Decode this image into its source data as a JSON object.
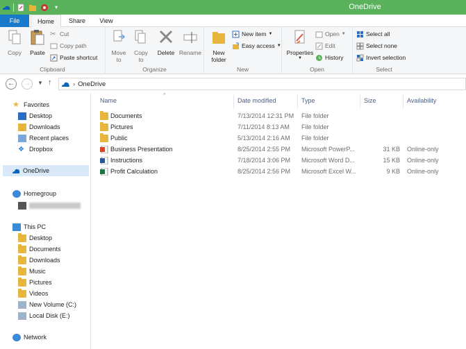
{
  "window": {
    "title": "OneDrive"
  },
  "tabs": [
    {
      "label": "File"
    },
    {
      "label": "Home"
    },
    {
      "label": "Share"
    },
    {
      "label": "View"
    }
  ],
  "ribbon": {
    "clipboard": {
      "label": "Clipboard",
      "copy": "Copy",
      "paste": "Paste",
      "cut": "Cut",
      "copy_path": "Copy path",
      "paste_shortcut": "Paste shortcut"
    },
    "organize": {
      "label": "Organize",
      "move_to": "Move\nto",
      "copy_to": "Copy\nto",
      "delete": "Delete",
      "rename": "Rename"
    },
    "new": {
      "label": "New",
      "new_folder": "New\nfolder",
      "new_item": "New item",
      "easy_access": "Easy access"
    },
    "open": {
      "label": "Open",
      "properties": "Properties",
      "open": "Open",
      "edit": "Edit",
      "history": "History"
    },
    "select": {
      "label": "Select",
      "select_all": "Select all",
      "select_none": "Select none",
      "invert_selection": "Invert selection"
    }
  },
  "address": {
    "location": "OneDrive"
  },
  "nav": {
    "favorites": "Favorites",
    "favorites_items": [
      "Desktop",
      "Downloads",
      "Recent places",
      "Dropbox"
    ],
    "onedrive": "OneDrive",
    "homegroup": "Homegroup",
    "this_pc": "This PC",
    "pc_items": [
      "Desktop",
      "Documents",
      "Downloads",
      "Music",
      "Pictures",
      "Videos",
      "New Volume (C:)",
      "Local Disk (E:)"
    ],
    "network": "Network"
  },
  "columns": {
    "name": "Name",
    "date": "Date modified",
    "type": "Type",
    "size": "Size",
    "availability": "Availability"
  },
  "files": [
    {
      "name": "Documents",
      "date": "7/13/2014 12:31 PM",
      "type": "File folder",
      "size": "",
      "availability": "",
      "icon": "folder"
    },
    {
      "name": "Pictures",
      "date": "7/11/2014 8:13 AM",
      "type": "File folder",
      "size": "",
      "availability": "",
      "icon": "folder"
    },
    {
      "name": "Public",
      "date": "5/13/2014 2:16 AM",
      "type": "File folder",
      "size": "",
      "availability": "",
      "icon": "folder"
    },
    {
      "name": "Business Presentation",
      "date": "8/25/2014 2:55 PM",
      "type": "Microsoft PowerP...",
      "size": "31 KB",
      "availability": "Online-only",
      "icon": "powerpoint"
    },
    {
      "name": "Instructions",
      "date": "7/18/2014 3:06 PM",
      "type": "Microsoft Word D...",
      "size": "15 KB",
      "availability": "Online-only",
      "icon": "word"
    },
    {
      "name": "Profit Calculation",
      "date": "8/25/2014 2:56 PM",
      "type": "Microsoft Excel W...",
      "size": "9 KB",
      "availability": "Online-only",
      "icon": "excel"
    }
  ],
  "colors": {
    "titlebar": "#5bb25c",
    "file_tab": "#1979ca",
    "selected": "#d9e9f8",
    "header_text": "#4d6185"
  }
}
